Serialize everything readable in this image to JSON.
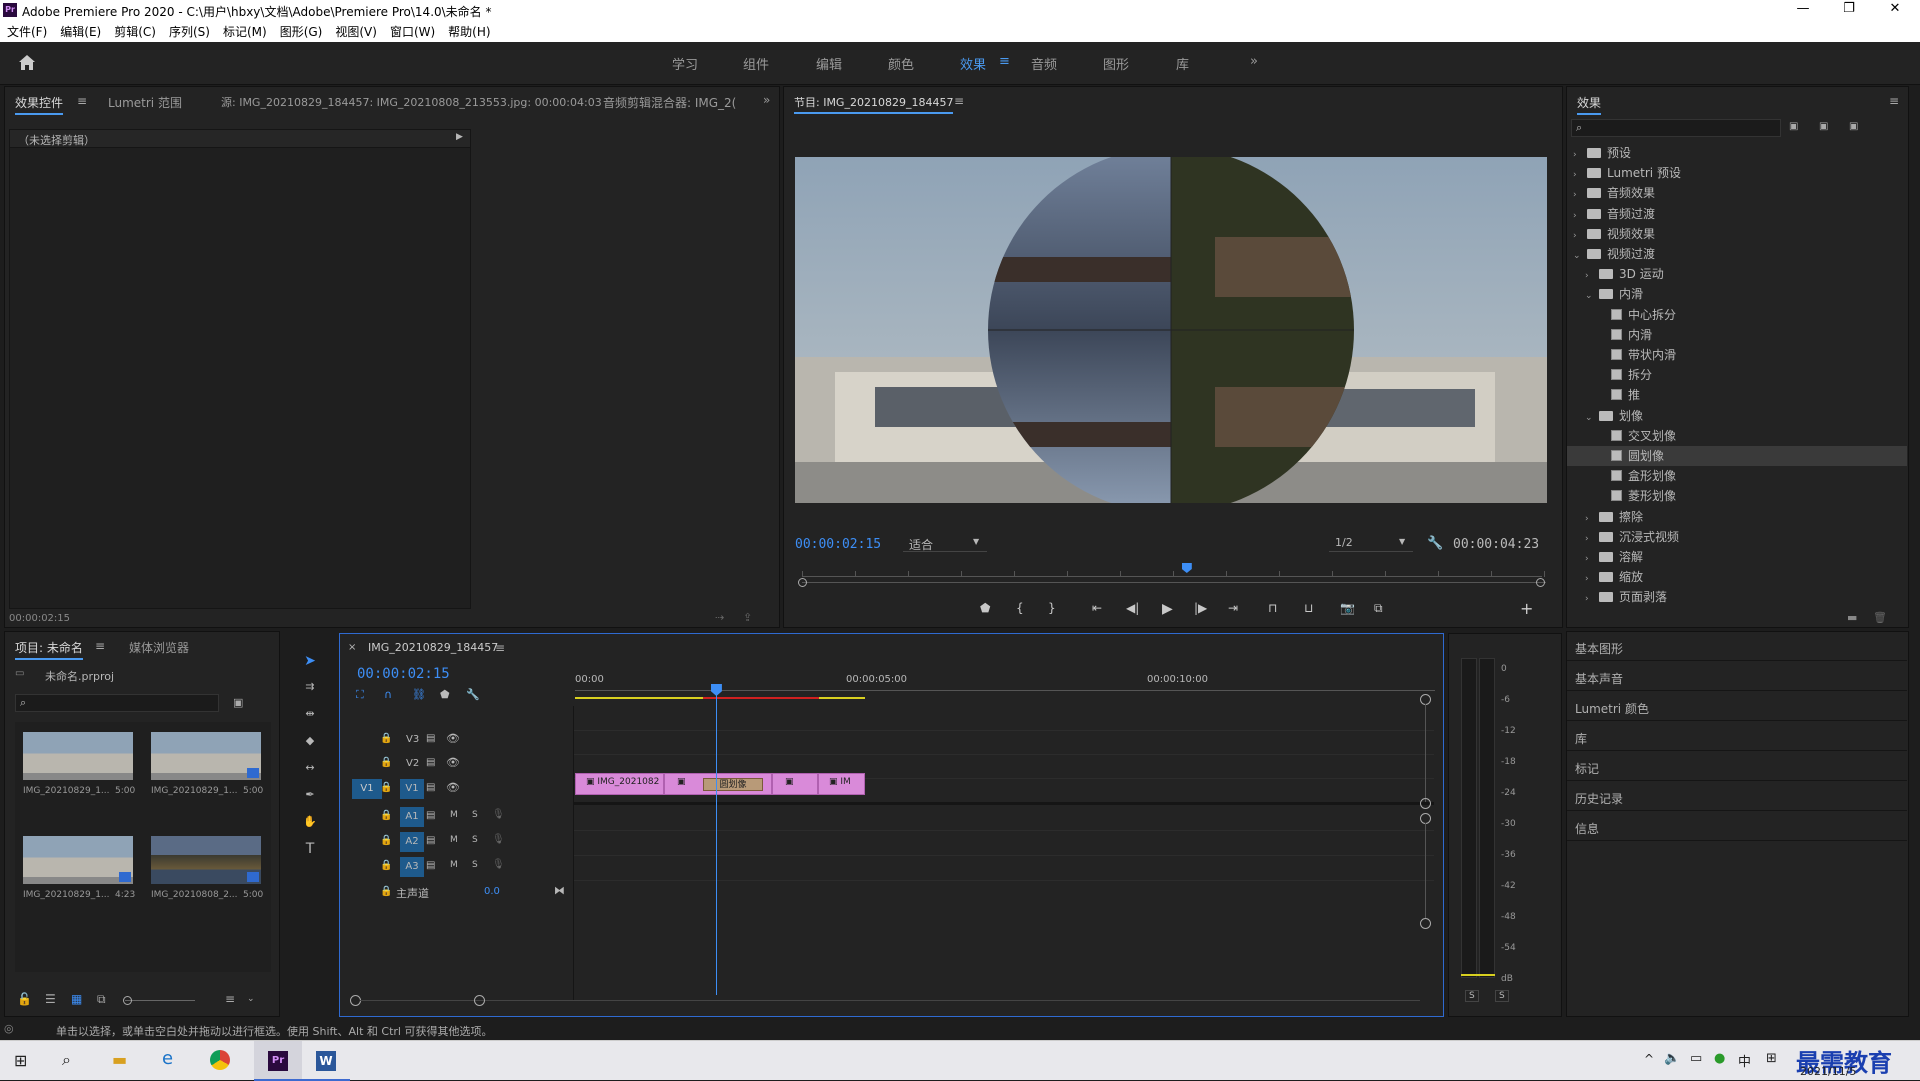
{
  "window": {
    "title": "Adobe Premiere Pro 2020 - C:\\用户\\hbxy\\文档\\Adobe\\Premiere Pro\\14.0\\未命名 *",
    "logo": "Pr"
  },
  "menu": [
    "文件(F)",
    "编辑(E)",
    "剪辑(C)",
    "序列(S)",
    "标记(M)",
    "图形(G)",
    "视图(V)",
    "窗口(W)",
    "帮助(H)"
  ],
  "workspaces": [
    "学习",
    "组件",
    "编辑",
    "颜色",
    "效果",
    "音频",
    "图形",
    "库"
  ],
  "active_workspace": "效果",
  "source_panel": {
    "tabs": [
      "效果控件",
      "Lumetri 范围",
      "源: IMG_20210829_184457: IMG_20210808_213553.jpg: 00:00:04:03",
      "音频剪辑混合器: IMG_2("
    ],
    "no_clip": "（未选择剪辑）",
    "timecode": "00:00:02:15"
  },
  "program": {
    "title": "节目: IMG_20210829_184457",
    "timecode": "00:00:02:15",
    "fit": "适合",
    "resolution": "1/2",
    "duration": "00:00:04:23",
    "playhead_fraction": 0.52
  },
  "effects": {
    "title": "效果",
    "search_placeholder": "",
    "tree": [
      {
        "label": "预设",
        "level": 0,
        "kind": "folder",
        "state": "collapsed"
      },
      {
        "label": "Lumetri 预设",
        "level": 0,
        "kind": "folder",
        "state": "collapsed"
      },
      {
        "label": "音频效果",
        "level": 0,
        "kind": "folder",
        "state": "collapsed"
      },
      {
        "label": "音频过渡",
        "level": 0,
        "kind": "folder",
        "state": "collapsed"
      },
      {
        "label": "视频效果",
        "level": 0,
        "kind": "folder",
        "state": "collapsed"
      },
      {
        "label": "视频过渡",
        "level": 0,
        "kind": "folder",
        "state": "expanded"
      },
      {
        "label": "3D 运动",
        "level": 1,
        "kind": "folder",
        "state": "collapsed"
      },
      {
        "label": "内滑",
        "level": 1,
        "kind": "folder",
        "state": "expanded"
      },
      {
        "label": "中心拆分",
        "level": 2,
        "kind": "effect"
      },
      {
        "label": "内滑",
        "level": 2,
        "kind": "effect"
      },
      {
        "label": "带状内滑",
        "level": 2,
        "kind": "effect"
      },
      {
        "label": "拆分",
        "level": 2,
        "kind": "effect"
      },
      {
        "label": "推",
        "level": 2,
        "kind": "effect"
      },
      {
        "label": "划像",
        "level": 1,
        "kind": "folder",
        "state": "expanded"
      },
      {
        "label": "交叉划像",
        "level": 2,
        "kind": "effect"
      },
      {
        "label": "圆划像",
        "level": 2,
        "kind": "effect",
        "selected": true
      },
      {
        "label": "盒形划像",
        "level": 2,
        "kind": "effect"
      },
      {
        "label": "菱形划像",
        "level": 2,
        "kind": "effect"
      },
      {
        "label": "擦除",
        "level": 1,
        "kind": "folder",
        "state": "collapsed"
      },
      {
        "label": "沉浸式视频",
        "level": 1,
        "kind": "folder",
        "state": "collapsed"
      },
      {
        "label": "溶解",
        "level": 1,
        "kind": "folder",
        "state": "collapsed"
      },
      {
        "label": "缩放",
        "level": 1,
        "kind": "folder",
        "state": "collapsed"
      },
      {
        "label": "页面剥落",
        "level": 1,
        "kind": "folder",
        "state": "collapsed"
      }
    ]
  },
  "side_panels": [
    "基本图形",
    "基本声音",
    "Lumetri 颜色",
    "库",
    "标记",
    "历史记录",
    "信息"
  ],
  "project": {
    "tabs": [
      "项目: 未命名",
      "媒体浏览器"
    ],
    "file": "未命名.prproj",
    "items": [
      {
        "name": "IMG_20210829_1...",
        "duration": "5:00"
      },
      {
        "name": "IMG_20210829_1...",
        "duration": "5:00"
      },
      {
        "name": "IMG_20210829_1...",
        "duration": "4:23"
      },
      {
        "name": "IMG_20210808_2...",
        "duration": "5:00"
      }
    ]
  },
  "timeline": {
    "tab": "IMG_20210829_184457",
    "timecode": "00:00:02:15",
    "ruler": [
      "00:00",
      "00:00:05:00",
      "00:00:10:00"
    ],
    "video_tracks": [
      "V3",
      "V2",
      "V1"
    ],
    "audio_tracks": [
      "A1",
      "A2",
      "A3"
    ],
    "source_patch": "V1",
    "master": "主声道",
    "master_value": "0.0",
    "clips": [
      {
        "label": "IMG_2021082"
      },
      {
        "label": ""
      },
      {
        "label": "圆划像"
      },
      {
        "label": ""
      },
      {
        "label": "IM"
      }
    ],
    "playhead_seconds": 2.6
  },
  "meter": {
    "scale": [
      "0",
      "-6",
      "-12",
      "-18",
      "-24",
      "-30",
      "-36",
      "-42",
      "-48",
      "-54",
      "dB"
    ],
    "solo": [
      "S",
      "S"
    ]
  },
  "status": "单击以选择，或单击空白处并拖动以进行框选。使用 Shift、Alt 和 Ctrl 可获得其他选项。",
  "taskbar": {
    "date": "2021/11/5",
    "ime": "中",
    "watermark": "最需教育"
  }
}
